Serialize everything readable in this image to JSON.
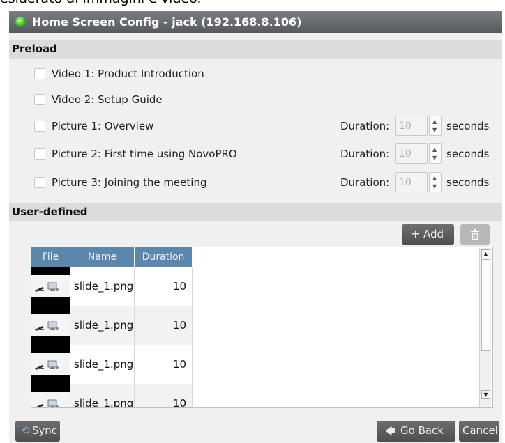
{
  "caption": "esiderato di immagini e video.",
  "window": {
    "title": "Home Screen Config - jack (192.168.8.106)"
  },
  "preload": {
    "header": "Preload",
    "items": [
      {
        "label": "Video 1: Product Introduction",
        "checked": false
      },
      {
        "label": "Video 2: Setup Guide",
        "checked": false
      },
      {
        "label": "Picture 1: Overview",
        "checked": false,
        "duration_label": "Duration:",
        "duration_value": "10",
        "unit": "seconds"
      },
      {
        "label": "Picture 2: First time using NovoPRO",
        "checked": false,
        "duration_label": "Duration:",
        "duration_value": "10",
        "unit": "seconds"
      },
      {
        "label": "Picture 3: Joining the meeting",
        "checked": false,
        "duration_label": "Duration:",
        "duration_value": "10",
        "unit": "seconds"
      }
    ]
  },
  "user_defined": {
    "header": "User-defined",
    "add_label": "Add",
    "columns": [
      "File",
      "Name",
      "Duration"
    ],
    "rows": [
      {
        "name": "slide_1.png",
        "duration": "10"
      },
      {
        "name": "slide_1.png",
        "duration": "10"
      },
      {
        "name": "slide_1.png",
        "duration": "10"
      },
      {
        "name": "slide_1.png",
        "duration": "10"
      }
    ]
  },
  "footer": {
    "sync_label": "Sync",
    "back_label": "Go Back",
    "cancel_label": "Cancel"
  },
  "colors": {
    "titlebar": "#55585d",
    "table_header": "#5b87ad",
    "button": "#4e4e4e"
  },
  "icons": [
    "status-dot-icon",
    "plus-icon",
    "trash-icon",
    "edit-icon",
    "preview-icon",
    "sync-icon",
    "back-arrow-icon"
  ]
}
